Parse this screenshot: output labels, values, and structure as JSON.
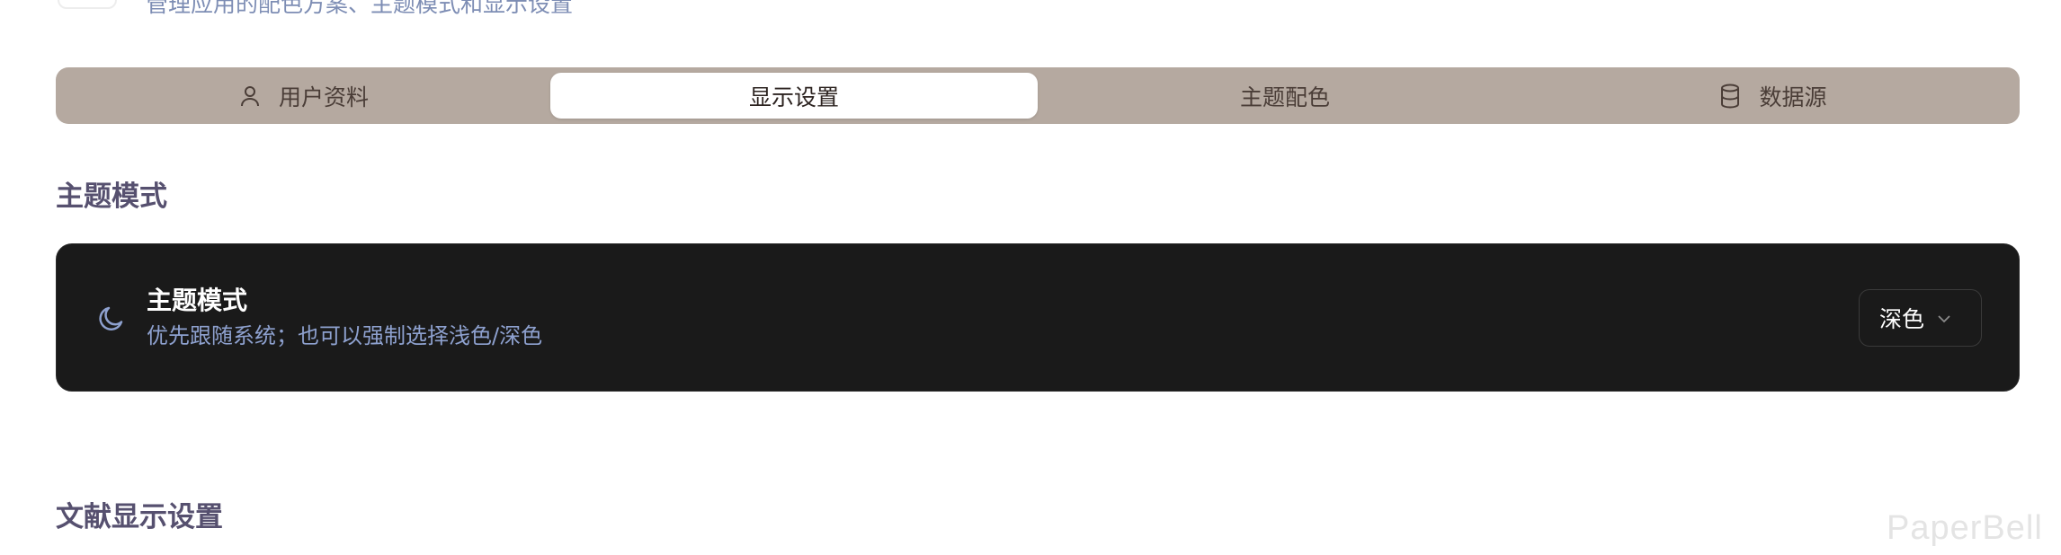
{
  "header": {
    "subtitle": "管理应用的配色方案、主题模式和显示设置"
  },
  "tabs": [
    {
      "label": "用户资料",
      "icon": "user-icon",
      "active": false
    },
    {
      "label": "显示设置",
      "icon": "",
      "active": true
    },
    {
      "label": "主题配色",
      "icon": "",
      "active": false
    },
    {
      "label": "数据源",
      "icon": "database-icon",
      "active": false
    }
  ],
  "sections": {
    "theme_mode_title": "主题模式",
    "document_display_title": "文献显示设置"
  },
  "theme_card": {
    "icon": "moon-icon",
    "title": "主题模式",
    "description": "优先跟随系统；也可以强制选择浅色/深色",
    "select_value": "深色"
  },
  "watermark": "PaperBell",
  "colors": {
    "tabbar_bg": "#b5a9a0",
    "card_bg": "#1a1a1a",
    "accent_blue": "#8ea1cf",
    "section_title": "#56506f"
  }
}
